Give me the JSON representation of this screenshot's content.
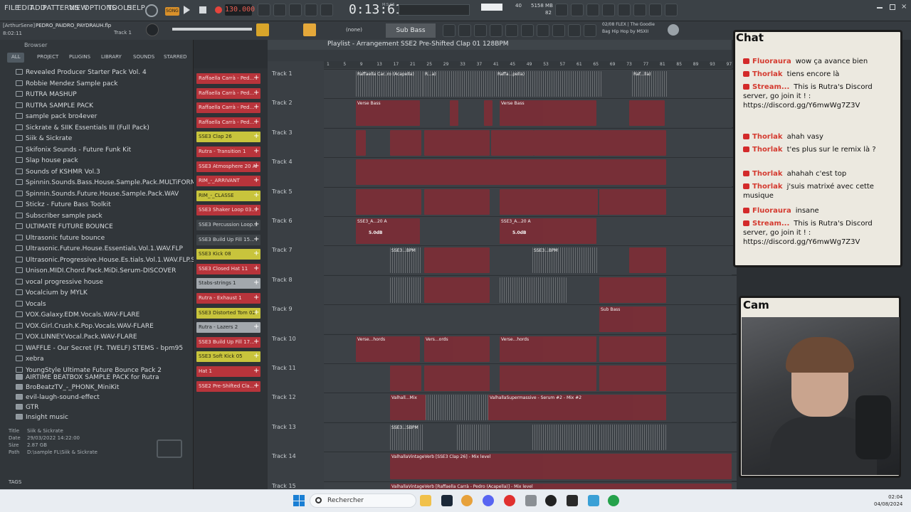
{
  "menu": [
    "FILE",
    "EDIT",
    "ADD",
    "PATTERNS",
    "VIEW",
    "OPTIONS",
    "TOOLS",
    "HELP"
  ],
  "transport": {
    "mode": "SONG",
    "bpm": "130.000",
    "time": "0:13:61",
    "time_label": "M:S:CS",
    "cpu": "40",
    "mem": "5158 MB",
    "poly": "82"
  },
  "project": {
    "user": "[ArthurSene]",
    "file": "PEDRO_PAIDRO_PAYDRAUH.flp",
    "clock": "8:02:11",
    "track": "Track 1"
  },
  "hint": {
    "line1": "02/08  FLEX | The Goodie",
    "line2": "Bag Hip Hop by MSXII"
  },
  "toolbar2": {
    "none_label": "(none)",
    "preset": "Sub Bass"
  },
  "browser": {
    "title": "Browser",
    "tabs": [
      "ALL",
      "PROJECT",
      "PLUGINS",
      "LIBRARY",
      "SOUNDS",
      "STARRED"
    ],
    "items": [
      "Revealed Producer Starter Pack Vol. 4",
      "Robbie Mendez Sample pack",
      "RUTRA MASHUP",
      "RUTRA SAMPLE PACK",
      "sample pack bro4ever",
      "Sickrate & SIIK Essentials III (Full Pack)",
      "Siik & Sickrate",
      "Skifonix Sounds - Future Funk Kit",
      "Slap house pack",
      "Sounds of KSHMR Vol.3",
      "Spinnin.Sounds.Bass.House.Sample.Pack.MULTiFORMAT-FLARE",
      "Spinnin.Sounds.Future.House.Sample.Pack.WAV",
      "Stickz - Future Bass Toolkit",
      "Subscriber sample pack",
      "ULTIMATE FUTURE BOUNCE",
      "Ultrasonic future bounce",
      "Ultrasonic.Future.House.Essentials.Vol.1.WAV.FLP",
      "Ultrasonic.Progressive.House.Es.tials.Vol.1.WAV.FLP.SBF.FXB.FXP",
      "Unison.MIDI.Chord.Pack.MiDi.Serum-DISCOVER",
      "vocal progressive house",
      "Vocalcium by MYLK",
      "Vocals",
      "VOX.Galaxy.EDM.Vocals.WAV-FLARE",
      "VOX.Girl.Crush.K.Pop.Vocals.WAV-FLARE",
      "VOX.LINNEY.Vocal.Pack.WAV-FLARE",
      "WAFFLE - Our Secret (Ft. TWELF) STEMS - bpm95",
      "xebra",
      "YoungStyle Ultimate Future Bounce Pack 2"
    ],
    "files": [
      "AIRTIME BEATBOX SAMPLE PACK for Rutra",
      "BroBeatzTV_-_PHONK_MiniKit",
      "evil-laugh-sound-effect",
      "GTR",
      "Insight music"
    ],
    "info": {
      "title_label": "Title",
      "title": "Siik & Sickrate",
      "date_label": "Date",
      "date": "29/03/2022 14:22:00",
      "size_label": "Size",
      "size": "2.87 GB",
      "path_label": "Path",
      "path": "D:\\sample FL\\Siik & Sickrate"
    },
    "tags": "TAGS"
  },
  "channels": [
    {
      "name": "Raffaella Carrà - Ped...",
      "color": "red"
    },
    {
      "name": "Raffaella Carrà - Ped...",
      "color": "red"
    },
    {
      "name": "Raffaella Carrà - Ped...",
      "color": "red"
    },
    {
      "name": "Raffaella Carrà - Ped...",
      "color": "red"
    },
    {
      "name": "SSE3 Clap 26",
      "color": "yel"
    },
    {
      "name": "Rutra - Transition 1",
      "color": "red"
    },
    {
      "name": "SSE3 Atmosphere 20 A",
      "color": "red"
    },
    {
      "name": "RIM_-_ARRIVANT",
      "color": "red"
    },
    {
      "name": "RIM_-_CLASSE",
      "color": "yel"
    },
    {
      "name": "SSE3 Shaker Loop 03...",
      "color": "red"
    },
    {
      "name": "SSE3 Percussion Loop...",
      "color": "dark"
    },
    {
      "name": "SSE3 Build Up Fill 15...",
      "color": "dark"
    },
    {
      "name": "SSE3 Kick 08",
      "color": "yel"
    },
    {
      "name": "SSE3 Closed Hat 11",
      "color": "red"
    },
    {
      "name": "Stabs-strings 1",
      "color": "grey"
    },
    {
      "name": "Rutra - Exhaust 1",
      "color": "red"
    },
    {
      "name": "SSE3 Distorted Tom 02",
      "color": "yel"
    },
    {
      "name": "Rutra - Lazers 2",
      "color": "grey"
    },
    {
      "name": "SSE3 Build Up Fill 17...",
      "color": "red"
    },
    {
      "name": "SSE3 Soft Kick 05",
      "color": "yel"
    },
    {
      "name": "Hat 1",
      "color": "red"
    },
    {
      "name": "SSE2 Pre-Shifted Cla...",
      "color": "red"
    }
  ],
  "playlist": {
    "title": "Playlist - Arrangement",
    "pattern": "SSE2 Pre-Shifted Clap 01 128BPM",
    "ruler": [
      "1",
      "5",
      "9",
      "13",
      "17",
      "21",
      "25",
      "29",
      "33",
      "37",
      "41",
      "45",
      "49",
      "53",
      "57",
      "61",
      "65",
      "69",
      "73",
      "77",
      "81",
      "85",
      "89",
      "93",
      "97"
    ],
    "tracks": [
      "Track 1",
      "Track 2",
      "Track 3",
      "Track 4",
      "Track 5",
      "Track 6",
      "Track 7",
      "Track 8",
      "Track 9",
      "Track 10",
      "Track 11",
      "Track 12",
      "Track 13",
      "Track 14",
      "Track 15"
    ],
    "clip_labels": {
      "t1": "Raffaella Car..ro (Acapella)",
      "t1b": "R...a)",
      "t1c": "Raffa...pella)",
      "t1d": "Raff...lla)",
      "t1e": "Raf...lla)",
      "t2": "Verse Bass",
      "t6": "SSE3_A...20 A",
      "t6db": "5.0dB",
      "t7": "SSE3...BPM",
      "t9": "Sub Bass",
      "t10": "Verse...hords",
      "t10b": "Vers...ords",
      "t12": "Valhall...Mix",
      "t12b": "ValhallaSupermassive - Serum #2 - Mix #2",
      "t13": "SSE3...5BPM",
      "t14": "ValhallaVintageVerb [SSE3 Clap 26] - Mix level",
      "t15": "ValhallaVintageVerb [Raffaella Carrà - Pedro (Acapella)] - Mix level"
    }
  },
  "chat": {
    "title": "Chat",
    "messages": [
      {
        "user": "Fluoraura",
        "text": "wow ça avance bien"
      },
      {
        "user": "Thorlak",
        "text": "tiens encore là"
      },
      {
        "user": "Stream...",
        "text": "This is Rutra's Discord server, go join it ! : https://discord.gg/Y6mwWg7Z3V"
      },
      {
        "user": "Thorlak",
        "text": "ahah vasy"
      },
      {
        "user": "Thorlak",
        "text": "t'es plus sur le remix là ?"
      },
      {
        "user": "Thorlak",
        "text": "ahahah c'est top"
      },
      {
        "user": "Thorlak",
        "text": "j'suis matrixé avec cette musique"
      },
      {
        "user": "Fluoraura",
        "text": "insane"
      },
      {
        "user": "Stream...",
        "text": "This is Rutra's Discord server, go join it ! : https://discord.gg/Y6mwWg7Z3V"
      }
    ]
  },
  "cam": {
    "title": "Cam"
  },
  "taskbar": {
    "search_placeholder": "Rechercher",
    "time": "02:04",
    "date": "04/08/2024"
  },
  "colors": {
    "clip": "#e07983",
    "accent": "#d8902a",
    "chat_name": "#d43a2f"
  }
}
